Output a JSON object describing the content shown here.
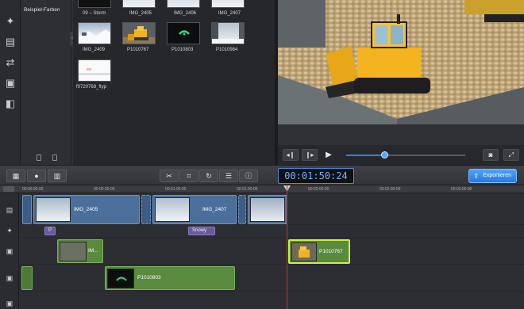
{
  "sidebar": {
    "category_label": "Beispiel-Farben",
    "icons": [
      "magic-wand-icon",
      "film-layout-icon",
      "transition-icon",
      "clapper-icon",
      "split-screen-icon"
    ]
  },
  "media": {
    "items": [
      {
        "label": "09 – Storm"
      },
      {
        "label": "IMG_2405"
      },
      {
        "label": "IMG_2406"
      },
      {
        "label": "IMG_2407"
      },
      {
        "label": "IMG_2409"
      },
      {
        "label": "P1010767"
      },
      {
        "label": "P1010803"
      },
      {
        "label": "P1010984"
      },
      {
        "label": "f0720768_ftyp"
      }
    ]
  },
  "player": {
    "icons": [
      "step-back-icon",
      "step-forward-icon",
      "play-icon",
      "snapshot-icon",
      "fullscreen-icon"
    ],
    "progress_fraction": 0.32
  },
  "toolbar": {
    "timecode": "00:01:50:24",
    "export_label": "Exportieren",
    "icons": [
      "media-import-icon",
      "mic-icon",
      "trash-icon",
      "cut-icon",
      "crop-icon",
      "rotate-icon",
      "adjust-icon",
      "info-icon"
    ]
  },
  "ruler": {
    "labels": [
      "00:00:00:00",
      "00:00:30:00",
      "00:01:00:00",
      "00:01:30:00",
      "00:02:00:00",
      "00:02:30:00",
      "00:03:00:00"
    ]
  },
  "timeline": {
    "video_clips": [
      {
        "label": "IMG_2405"
      },
      {
        "label": "IMG_2407"
      }
    ],
    "title_clips": [
      {
        "label": "P"
      },
      {
        "label": "Snowy"
      }
    ],
    "overlay_clips": [
      {
        "label": "IM..."
      },
      {
        "label": "P1010767"
      }
    ],
    "audio_clips": [
      {
        "label": "P1010803"
      }
    ]
  },
  "colors": {
    "accent": "#2f7fe0",
    "video_clip": "#4b6f9b",
    "audio_clip": "#5a8a3e",
    "title_clip": "#6a5a9a",
    "playhead": "#b03a3a"
  }
}
